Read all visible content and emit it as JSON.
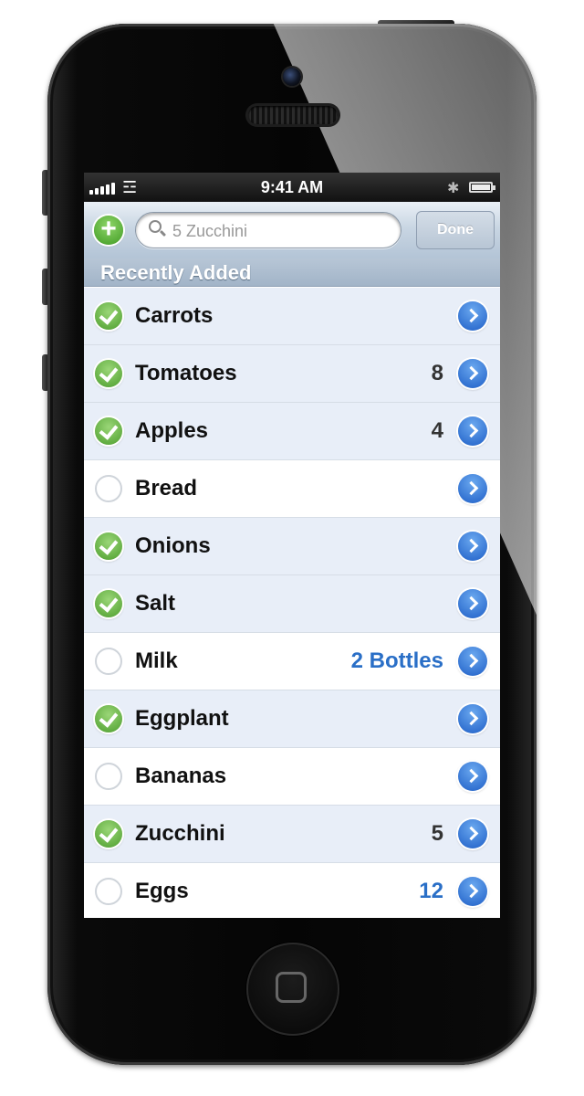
{
  "status_bar": {
    "time": "9:41 AM",
    "icons": [
      "signal-icon",
      "wifi-icon",
      "bluetooth-icon",
      "battery-icon"
    ]
  },
  "toolbar": {
    "add_icon": "plus-circle-icon",
    "search": {
      "value": "5 Zucchini",
      "icon": "search-icon"
    },
    "done_label": "Done"
  },
  "section": {
    "title": "Recently Added"
  },
  "items": [
    {
      "label": "Carrots",
      "quantity": "",
      "checked": true
    },
    {
      "label": "Tomatoes",
      "quantity": "8",
      "checked": true
    },
    {
      "label": "Apples",
      "quantity": "4",
      "checked": true
    },
    {
      "label": "Bread",
      "quantity": "",
      "checked": false
    },
    {
      "label": "Onions",
      "quantity": "",
      "checked": true
    },
    {
      "label": "Salt",
      "quantity": "",
      "checked": true
    },
    {
      "label": "Milk",
      "quantity": "2 Bottles",
      "checked": false
    },
    {
      "label": "Eggplant",
      "quantity": "",
      "checked": true
    },
    {
      "label": "Bananas",
      "quantity": "",
      "checked": false
    },
    {
      "label": "Zucchini",
      "quantity": "5",
      "checked": true
    },
    {
      "label": "Eggs",
      "quantity": "12",
      "checked": false
    }
  ],
  "colors": {
    "checked_row": "#e8eef8",
    "unchecked_row": "#ffffff",
    "check_green": "#4d9e2e",
    "disclosure_blue": "#1f5fc7",
    "quantity_blue": "#2a6fc7"
  }
}
